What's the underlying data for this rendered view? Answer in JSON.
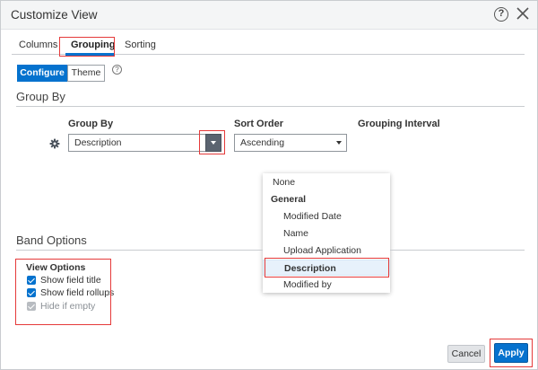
{
  "dialog": {
    "title": "Customize View",
    "help_icon": "question-circle-icon",
    "close_icon": "close-icon"
  },
  "tabs": [
    {
      "label": "Columns",
      "selected": false
    },
    {
      "label": "Grouping",
      "selected": true
    },
    {
      "label": "Sorting",
      "selected": false
    }
  ],
  "mode_toggle": {
    "configure_label": "Configure",
    "theme_label": "Theme",
    "selected": "Configure",
    "info_icon": "question-circle-icon"
  },
  "group_by_section": {
    "title": "Group By",
    "group_by_label": "Group By",
    "sort_order_label": "Sort Order",
    "grouping_interval_label": "Grouping Interval",
    "row_icon": "gear-icon",
    "group_by_value": "Description",
    "sort_order_value": "Ascending"
  },
  "group_by_dropdown": {
    "none_label": "None",
    "group_header": "General",
    "options": [
      "Modified Date",
      "Name",
      "Upload Application",
      "Description",
      "Modified by"
    ],
    "selected": "Description"
  },
  "band_options": {
    "title": "Band Options",
    "view_options_label": "View Options",
    "checkboxes": [
      {
        "label": "Show field title",
        "checked": true,
        "disabled": false
      },
      {
        "label": "Show field rollups",
        "checked": true,
        "disabled": false
      },
      {
        "label": "Hide if empty",
        "checked": true,
        "disabled": true
      }
    ]
  },
  "footer": {
    "cancel_label": "Cancel",
    "apply_label": "Apply"
  },
  "colors": {
    "accent": "#0572ce",
    "highlight_border": "#e53a3a",
    "selected_row_bg": "#e7f1fb"
  }
}
